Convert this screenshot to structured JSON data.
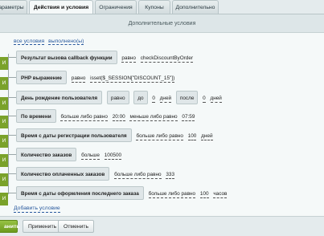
{
  "tabs": [
    {
      "label": "араметры"
    },
    {
      "label": "Действия и условия"
    },
    {
      "label": "Ограничения"
    },
    {
      "label": "Купоны"
    },
    {
      "label": "Дополнительно"
    }
  ],
  "section_title": "Дополнительные условия",
  "header": {
    "all": "все условия",
    "done": "выполнено(ы)"
  },
  "rail_marker": "И",
  "conditions": [
    {
      "label": "Результат вызова callback функции",
      "op": "равно",
      "value": "checkDiscountByOrder"
    },
    {
      "label": "PHP выражение",
      "op": "равно",
      "value": "isset($_SESSION[\"DISCOUNT_15\"])"
    },
    {
      "label": "День рождение пользователя",
      "op": "равно",
      "chip1": "до",
      "num1": "0",
      "unit1": "дней",
      "chip2": "после",
      "num2": "0",
      "unit2": "дней"
    },
    {
      "label": "По времени",
      "op1": "больше либо равно",
      "time1": "20:00",
      "op2": "меньше либо равно",
      "time2": "07:59"
    },
    {
      "label": "Время с даты регистрации пользователя",
      "op": "больше либо равно",
      "value": "100",
      "unit": "дней"
    },
    {
      "label": "Количество заказов",
      "op": "больше",
      "value": "100500"
    },
    {
      "label": "Количество оплаченных заказов",
      "op": "больше либо равно",
      "value": "333"
    },
    {
      "label": "Время с даты оформления последнего заказа",
      "op": "больше либо равно",
      "value": "100",
      "unit": "часов"
    }
  ],
  "add_condition": "Добавить условие",
  "buttons": {
    "save": "анить",
    "apply": "Применить",
    "cancel": "Отменить"
  }
}
